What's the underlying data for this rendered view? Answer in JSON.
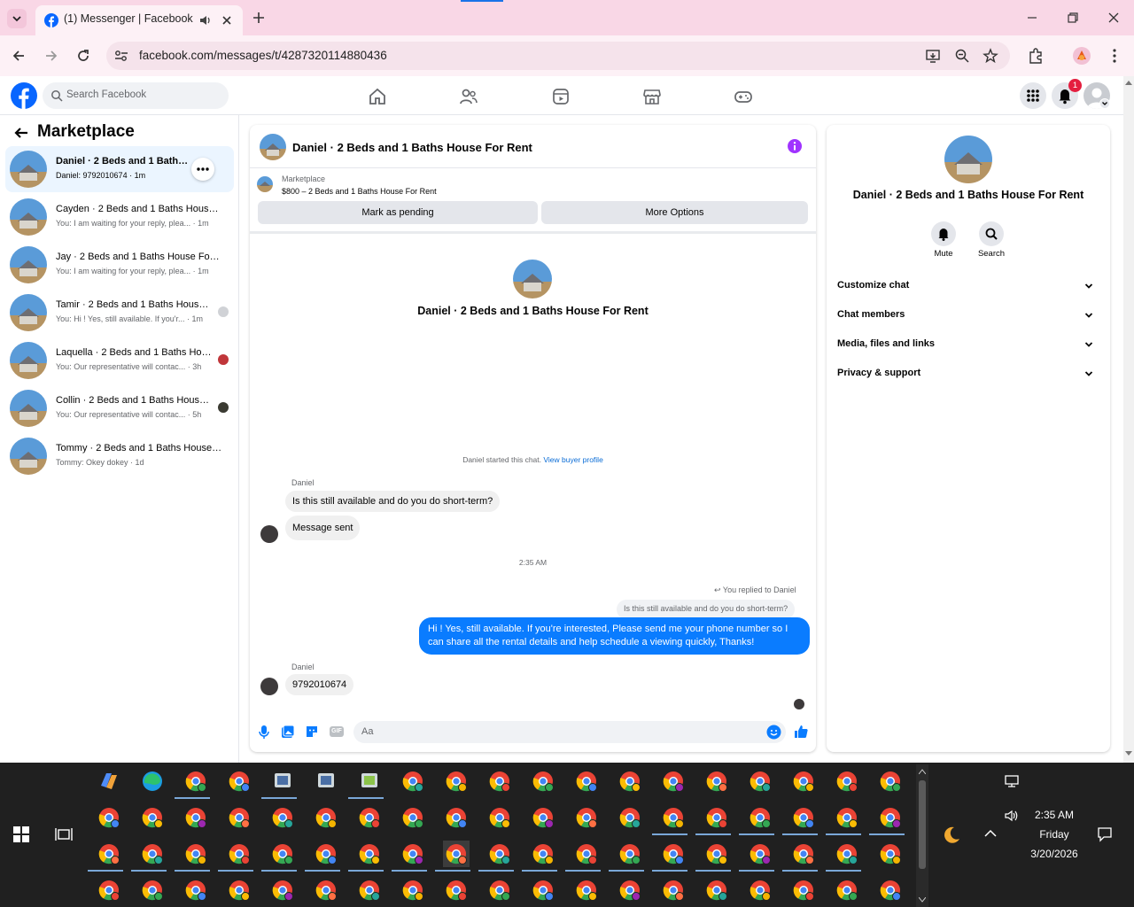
{
  "browser": {
    "tab_title": "(1) Messenger | Facebook",
    "url": "facebook.com/messages/t/4287320114880436",
    "colors": {
      "tabbar": "#f9d7e6",
      "toolbar": "#fdf1f6"
    }
  },
  "fb_header": {
    "search_placeholder": "Search Facebook",
    "notification_count": "1",
    "brand_color": "#0866ff"
  },
  "sidebar": {
    "title": "Marketplace",
    "conversations": [
      {
        "name": "Daniel · 2 Beds and 1 Baths House For Rent",
        "snippet": "Daniel: 9792010674 · 1m"
      },
      {
        "name": "Cayden · 2 Beds and 1 Baths House For Rent",
        "snippet": "You: I am waiting for your reply, plea... · 1m"
      },
      {
        "name": "Jay · 2 Beds and 1 Baths House For Rent",
        "snippet": "You: I am waiting for your reply, plea... · 1m"
      },
      {
        "name": "Tamir · 2 Beds and 1 Baths House For Rent",
        "snippet": "You: Hi ! Yes, still available. If you'r... · 1m"
      },
      {
        "name": "Laquella · 2 Beds and 1 Baths House For Rent",
        "snippet": "You: Our representative will contac... · 3h"
      },
      {
        "name": "Collin · 2 Beds and 1 Baths House For Rent",
        "snippet": "You: Our representative will contac... · 5h"
      },
      {
        "name": "Tommy · 2 Beds and 1 Baths House For Rent",
        "snippet": "Tommy: Okey dokey · 1d"
      }
    ]
  },
  "chat": {
    "title": "Daniel · 2 Beds and 1 Baths House For Rent",
    "listing_label": "Marketplace",
    "listing_detail": "$800 – 2 Beds and 1 Baths House For Rent",
    "mark_pending": "Mark as pending",
    "more_options": "More Options",
    "intro_name": "Daniel · 2 Beds and 1 Baths House For Rent",
    "started_text": "Daniel started this chat.",
    "buyer_profile_link": "View buyer profile",
    "sender_1": "Daniel",
    "msg_1": "Is this still available and do you do short-term?",
    "msg_2": "Message sent",
    "timestamp": "2:35 AM",
    "replied_to": "You replied to Daniel",
    "quoted": "Is this still available and do you do short-term?",
    "reply_line_1": "Hi ! Yes, still available. If you're interested, Please send me your phone number so I",
    "reply_line_2": "can share all the rental details and help schedule a viewing quickly, Thanks!",
    "sender_2": "Daniel",
    "msg_3": "9792010674",
    "composer_placeholder": "Aa",
    "outgoing_color": "#0a7cff"
  },
  "info_panel": {
    "title": "Daniel · 2 Beds and 1 Baths House For Rent",
    "mute": "Mute",
    "search": "Search",
    "sections": [
      "Customize chat",
      "Chat members",
      "Media, files and links",
      "Privacy & support"
    ]
  },
  "taskbar": {
    "time": "2:35 AM",
    "day": "Friday",
    "date": "3/20/2026"
  }
}
